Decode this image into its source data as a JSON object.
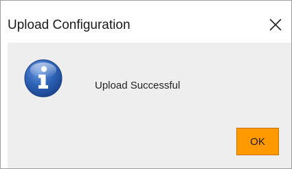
{
  "dialog": {
    "title": "Upload Configuration",
    "message": "Upload Successful",
    "ok_label": "OK",
    "icon": "info-icon",
    "close_icon": "close-icon"
  },
  "colors": {
    "button_bg": "#ff9900",
    "icon_blue": "#2a62b5",
    "content_bg": "#eeeeee"
  }
}
